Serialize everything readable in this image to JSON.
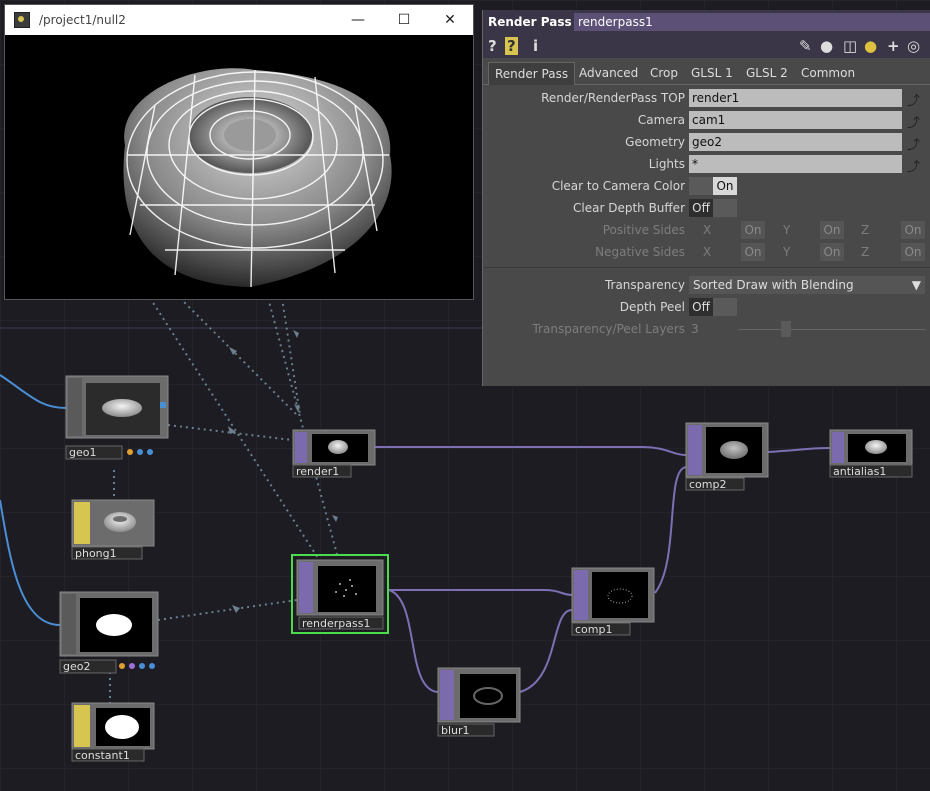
{
  "viewer": {
    "title": "/project1/null2",
    "minimize_icon": "minimize-icon",
    "maximize_icon": "maximize-icon",
    "close_icon": "close-icon"
  },
  "panel": {
    "op_type": "Render Pass",
    "op_name": "renderpass1",
    "toolbar_icons": [
      "help-icon",
      "op-help-icon",
      "info-icon",
      "edit-icon",
      "comment-icon",
      "clone-icon",
      "python-icon",
      "add-icon",
      "target-icon"
    ],
    "tabs": [
      "Render Pass",
      "Advanced",
      "Crop",
      "GLSL 1",
      "GLSL 2",
      "Common"
    ],
    "active_tab": "Render Pass",
    "params": {
      "render_top": {
        "label": "Render/RenderPass TOP",
        "value": "render1"
      },
      "camera": {
        "label": "Camera",
        "value": "cam1"
      },
      "geometry": {
        "label": "Geometry",
        "value": "geo2"
      },
      "lights": {
        "label": "Lights",
        "value": "*"
      },
      "clear_camera_color": {
        "label": "Clear to Camera Color",
        "value": "On"
      },
      "clear_depth_buffer": {
        "label": "Clear Depth Buffer",
        "value": "Off"
      },
      "positive_sides": {
        "label": "Positive Sides",
        "x": "X",
        "y": "Y",
        "z": "Z",
        "on": "On"
      },
      "negative_sides": {
        "label": "Negative Sides",
        "x": "X",
        "y": "Y",
        "z": "Z",
        "on": "On"
      },
      "transparency": {
        "label": "Transparency",
        "value": "Sorted Draw with Blending"
      },
      "depth_peel": {
        "label": "Depth Peel",
        "value": "Off"
      },
      "peel_layers": {
        "label": "Transparency/Peel Layers",
        "value": "3"
      }
    }
  },
  "nodes": {
    "geo1": "geo1",
    "phong1": "phong1",
    "geo2": "geo2",
    "constant1": "constant1",
    "render1": "render1",
    "renderpass1": "renderpass1",
    "blur1": "blur1",
    "comp1": "comp1",
    "comp2": "comp2",
    "antialias1": "antialias1"
  },
  "colors": {
    "network_bg": "#1c1c22",
    "top_wire": "#7e6fb4",
    "sop_wire": "#4a8fd6",
    "selected": "#4bdc4b",
    "mat_yellow": "#d8c450",
    "top_purple": "#7b6bae"
  }
}
